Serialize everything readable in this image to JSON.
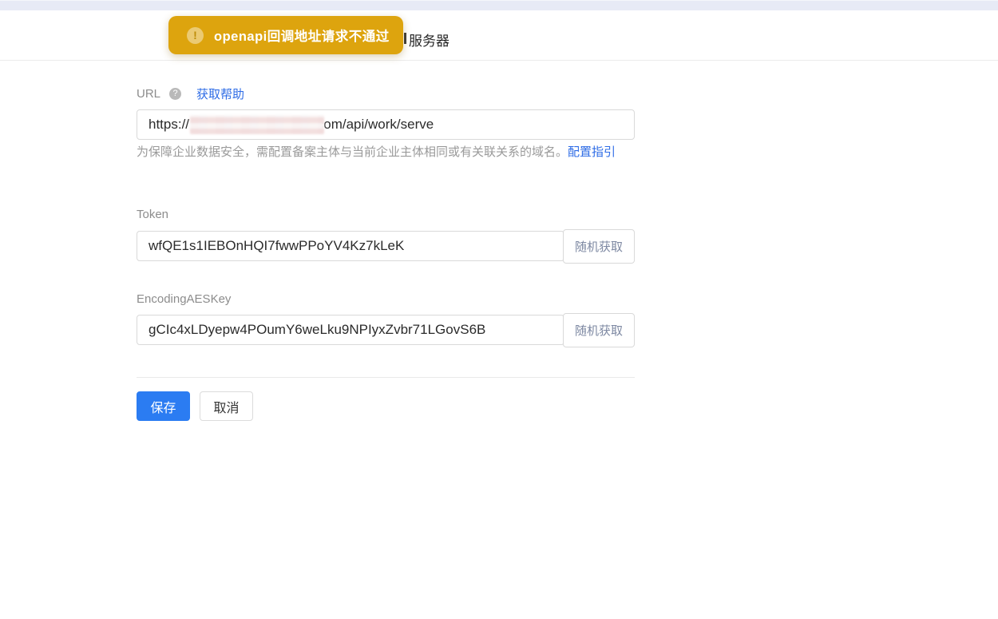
{
  "topbar": {},
  "toast": {
    "icon": "exclamation-icon",
    "icon_glyph": "!",
    "message": "openapi回调地址请求不通过",
    "bg_color": "#dda40e"
  },
  "header": {
    "title_visible": "服务器"
  },
  "form": {
    "url": {
      "label": "URL",
      "help_icon": "question-icon",
      "help_icon_glyph": "?",
      "help_link": "获取帮助",
      "value_prefix": "https://",
      "value_redacted": true,
      "value_suffix": ".com/api/work/serve",
      "hint_text": "为保障企业数据安全，需配置备案主体与当前企业主体相同或有关联关系的域名。",
      "hint_link": "配置指引"
    },
    "token": {
      "label": "Token",
      "value": "wfQE1s1IEBOnHQI7fwwPPoYV4Kz7kLeK",
      "random_label": "随机获取"
    },
    "aes_key": {
      "label": "EncodingAESKey",
      "value": "gCIc4xLDyepw4POumY6weLku9NPIyxZvbr71LGovS6B",
      "random_label": "随机获取"
    },
    "actions": {
      "save_label": "保存",
      "cancel_label": "取消"
    }
  },
  "colors": {
    "accent_blue": "#2b7cf2",
    "link_blue": "#2e6ce6",
    "toast_bg": "#dda40e",
    "topbar_bg": "#e7eaf6"
  }
}
